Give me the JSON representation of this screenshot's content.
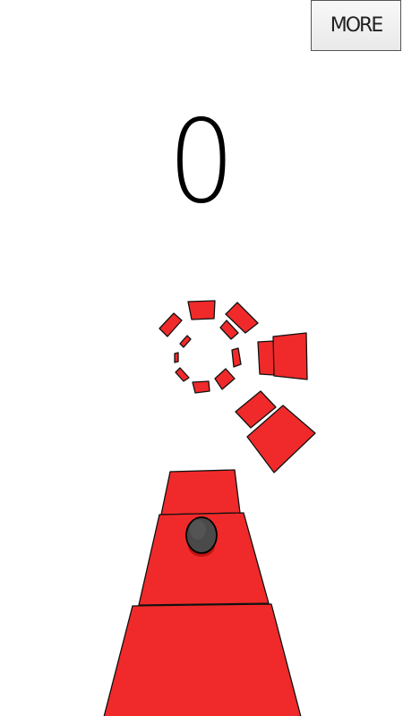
{
  "hud": {
    "more_label": "MORE",
    "score": "0"
  },
  "colors": {
    "block_fill": "#f02a2a",
    "block_stroke": "#111111",
    "ball_fill": "#4a4a4a",
    "ball_shadow": "#c01414"
  }
}
